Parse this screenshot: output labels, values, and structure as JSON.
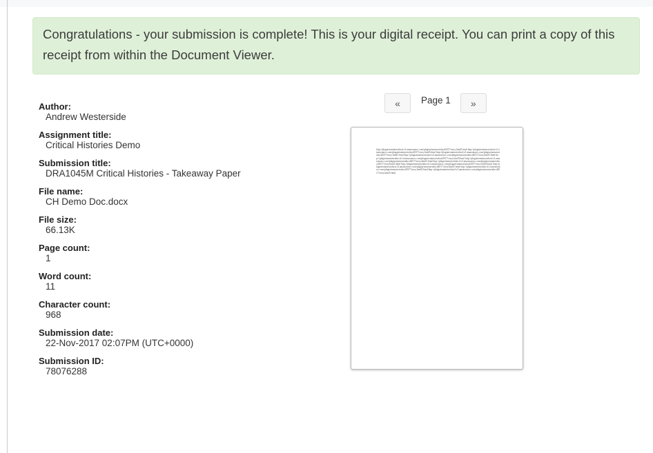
{
  "alert": {
    "message": "Congratulations - your submission is complete! This is your digital receipt. You can print a copy of this receipt from within the Document Viewer."
  },
  "receipt": {
    "fields": [
      {
        "label": "Author:",
        "value": "Andrew Westerside"
      },
      {
        "label": "Assignment title:",
        "value": "Critical Histories Demo"
      },
      {
        "label": "Submission title:",
        "value": "DRA1045M Critical Histories - Takeaway Paper"
      },
      {
        "label": "File name:",
        "value": "CH Demo Doc.docx"
      },
      {
        "label": "File size:",
        "value": "66.13K"
      },
      {
        "label": "Page count:",
        "value": "1"
      },
      {
        "label": "Word count:",
        "value": "11"
      },
      {
        "label": "Character count:",
        "value": "968"
      },
      {
        "label": "Submission date:",
        "value": "22-Nov-2017 02:07PM (UTC+0000)"
      },
      {
        "label": "Submission ID:",
        "value": "78076288"
      }
    ]
  },
  "viewer": {
    "prev_label": "«",
    "page_label": "Page 1",
    "next_label": "»",
    "document_text": "http://plagiarismtutorialucd.s3.amazonaws.com/plagiarismtutorialucd2017/story.html5.html http://plagiarismtutorialucd.s3.amazonaws.com/plagiarismtutorialucd2017/story.html5.html http://plagiarismtutorialucd.s3.amazonaws.com/plagiarismtutorialucd2017/story.html5.html http://plagiarismtutorialucd.s3.amazonaws.com/plagiarismtutorialucd2017/story.html5.html http://plagiarismtutorialucd.s3.amazonaws.com/plagiarismtutorialucd2017/story.html5.html http://plagiarismtutorialucd.s3.amazonaws.com/plagiarismtutorialucd2017/story.html5.html http://plagiarismtutorialucd.s3.amazonaws.com/plagiarismtutorialucd2017/story.html5.html http://plagiarismtutorialucd.s3.amazonaws.com/plagiarismtutorialucd2017/story.html5.html http://plagiarismtutorialucd.s3.amazonaws.com/plagiarismtutorialucd2017/story.html5.html http://plagiarismtutorialucd.s3.amazonaws.com/plagiarismtutorialucd2017/story.html5.html http://plagiarismtutorialucd.s3.amazonaws.com/plagiarismtutorialucd2017/story.html5.html"
  },
  "colors": {
    "alert_bg": "#dff0d8",
    "alert_border": "#d0e9c6"
  }
}
